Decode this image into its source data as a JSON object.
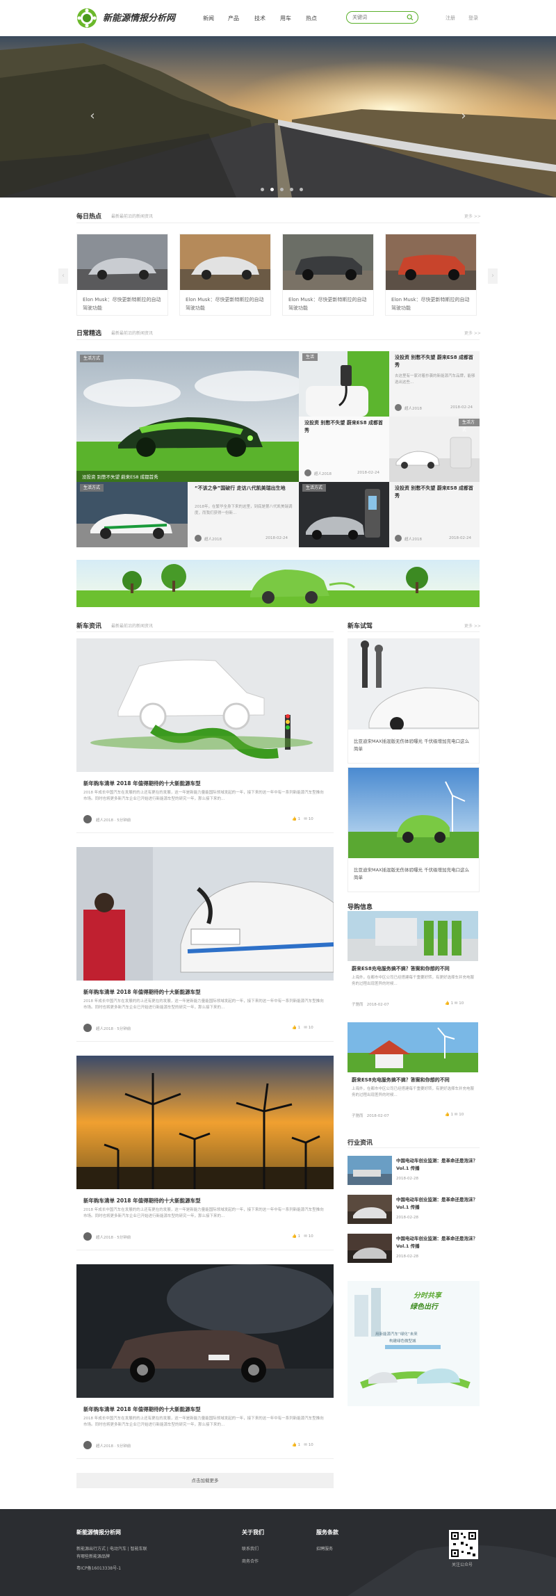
{
  "header": {
    "site_name": "新能源情报分析网",
    "nav": [
      "新闻",
      "产品",
      "技术",
      "用车",
      "热点"
    ],
    "search_placeholder": "关键词",
    "register": "注册",
    "login": "登录"
  },
  "banner": {
    "prev": "‹",
    "next": "›"
  },
  "daily_hot": {
    "title": "每日热点",
    "subtitle": "最新最前沿的新闻资讯",
    "more": "更多 >>",
    "items": [
      {
        "text": "Elon Musk：尽快更新特斯拉的自动驾驶功能"
      },
      {
        "text": "Elon Musk：尽快更新特斯拉的自动驾驶功能"
      },
      {
        "text": "Elon Musk：尽快更新特斯拉的自动驾驶功能"
      },
      {
        "text": "Elon Musk：尽快更新特斯拉的自动驾驶功能"
      }
    ]
  },
  "daily_pick": {
    "title": "日常精选",
    "subtitle": "最新最前沿的新闻资讯",
    "more": "更多 >>",
    "big_tag": "生活方式",
    "big_caption": "没投资 别憋不失望 蔚来ES8 成都首秀",
    "tiles": [
      {
        "tag": "生活",
        "title": "没投资 别憋不失望 蔚来ES8 成都首秀",
        "desc": "去这里有一家对着抄袭的新能源汽车品牌，能够选出这些...",
        "author": "超人2018",
        "date": "2018-02-24"
      },
      {
        "tag": "生活方式",
        "title": "没投资 别憋不失望 蔚来ES8 成都首秀",
        "desc": "",
        "author": "超人2018",
        "date": "2018-02-24"
      },
      {
        "tag": "生活方式",
        "title": "“不该之争”国破行 走访八代凯美瑞出生地",
        "desc": "2018年，在繁华全身下来的这里，到底是第八代凯美瑞调度，而我们获得一份新...",
        "author": "超人2018",
        "date": "2018-02-24"
      },
      {
        "tag": "生活方式",
        "title": "没投资 别憋不失望 蔚来ES8 成都首秀",
        "desc": "",
        "author": "超人2018",
        "date": "2018-02-24"
      }
    ]
  },
  "new_cars": {
    "title": "新车资讯",
    "subtitle": "最新最前沿的新闻资讯",
    "items": [
      {
        "title": "新年购车清单 2018 年值得期待的十大新能源车型",
        "desc": "2018 年成长中国汽车在发展的的上还有更在的发展，这一年是新能力量能国际领域发起的一年，接下来的这一年中有一系列新能源汽车型推向市场。同时也将更多新汽车企业已开始进行新能源车型的研究一年，那么接下来的...",
        "author": "超人2018",
        "time": "5分钟前",
        "likes": "1",
        "comments": "10"
      },
      {
        "title": "新年购车清单 2018 年值得期待的十大新能源车型",
        "desc": "2018 年成长中国汽车在发展的的上还有更在的发展，这一年是新能力量能国际领域发起的一年，接下来的这一年中有一系列新能源汽车型推向市场。同时也将更多新汽车企业已开始进行新能源车型的研究一年，那么接下来的...",
        "author": "超人2018",
        "time": "5分钟前",
        "likes": "1",
        "comments": "10"
      },
      {
        "title": "新年购车清单 2018 年值得期待的十大新能源车型",
        "desc": "2018 年成长中国汽车在发展的的上还有更在的发展，这一年是新能力量能国际领域发起的一年，接下来的这一年中有一系列新能源汽车型推向市场。同时也将更多新汽车企业已开始进行新能源车型的研究一年，那么接下来的...",
        "author": "超人2018",
        "time": "5分钟前",
        "likes": "1",
        "comments": "10"
      },
      {
        "title": "新年购车清单 2018 年值得期待的十大新能源车型",
        "desc": "2018 年成长中国汽车在发展的的上还有更在的发展，这一年是新能力量能国际领域发起的一年，接下来的这一年中有一系列新能源汽车型推向市场。同时也将更多新汽车企业已开始进行新能源车型的研究一年，那么接下来的...",
        "author": "超人2018",
        "time": "5分钟前",
        "likes": "1",
        "comments": "10"
      }
    ],
    "load_more": "点击加载更多"
  },
  "test_drive": {
    "title": "新车试驾",
    "more": "更多 >>",
    "items": [
      {
        "text": "比亚迪宋MAX插混版无伤体验曝光 千伏级增加充电口这么简单"
      },
      {
        "text": "比亚迪宋MAX插混版无伤体验曝光 千伏级增加充电口这么简单"
      }
    ]
  },
  "guide": {
    "title": "导购信息",
    "items": [
      {
        "title": "蔚来ES8充电服务搞不搞？答案和你想的不同",
        "desc": "上海外，在都市中区公司已经搭建每千重要好转，有更好选择车并充电服务的过程出现差异的时候...",
        "author": "子驰而",
        "date": "2018-02-07",
        "likes": "1",
        "comments": "10"
      },
      {
        "title": "蔚来ES8充电服务搞不搞？答案和你想的不同",
        "desc": "上海外，在都市中区公司已经搭建每千重要好转，有更好选择车并充电服务的过程出现差异的时候...",
        "author": "子驰而",
        "date": "2018-02-07",
        "likes": "1",
        "comments": "10"
      }
    ]
  },
  "industry": {
    "title": "行业资讯",
    "items": [
      {
        "title": "中国电动车创业监测：是革命还是泡沫？Vol.1 传播",
        "date": "2018-02-28"
      },
      {
        "title": "中国电动车创业监测：是革命还是泡沫？Vol.1 传播",
        "date": "2018-02-28"
      },
      {
        "title": "中国电动车创业监测：是革命还是泡沫？Vol.1 传播",
        "date": "2018-02-28"
      }
    ]
  },
  "ad": {
    "line1": "分时共享",
    "line2": "绿色出行",
    "line3": "用新能源汽车“绿化”未来",
    "line4": "构建绿色微型城"
  },
  "footer": {
    "site_name": "新能源情报分析网",
    "line1": "新能源出行方式 | 电动汽车 | 智能车联",
    "line2": "有哪些新能源品牌",
    "icp": "粤ICP备16013338号-1",
    "about_title": "关于我们",
    "about_links": [
      "联系我们",
      "商务合作"
    ],
    "service_title": "服务条款",
    "service_links": [
      "招聘服务"
    ],
    "qr_caption": "关注公众号"
  }
}
